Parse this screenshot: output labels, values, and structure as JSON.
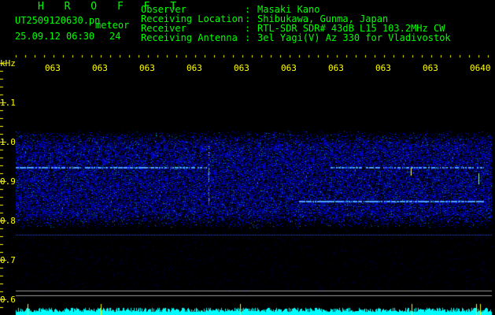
{
  "header": {
    "title": "H R O F F T",
    "filename": "UT2509120630.pn",
    "meteor_label": "meteor",
    "datetime": "25.09.12 06:30",
    "meteor_count": "24",
    "fields": [
      {
        "label": "Observer",
        "value": "Masaki Kano"
      },
      {
        "label": "Receiving Location",
        "value": "Shibukawa, Gunma, Japan"
      },
      {
        "label": "Receiver",
        "value": "RTL-SDR SDR# 43dB L15 103.2MHz CW"
      },
      {
        "label": "Receiving Antenna",
        "value": "3el Yagi(V) Az 330 for Vladivostok"
      }
    ]
  },
  "axes": {
    "y_unit": "kHz",
    "y_ticks": [
      "1.1",
      "1.0",
      "0.9",
      "0.8",
      "0.7",
      "0.6"
    ],
    "x_ticks": [
      "063",
      "063",
      "063",
      "063",
      "063",
      "063",
      "063",
      "063",
      "063",
      "0640"
    ]
  },
  "colors": {
    "label": "#00ff00",
    "tick": "#ffff00",
    "text": "#ffffff",
    "signal": "#00ffff"
  }
}
